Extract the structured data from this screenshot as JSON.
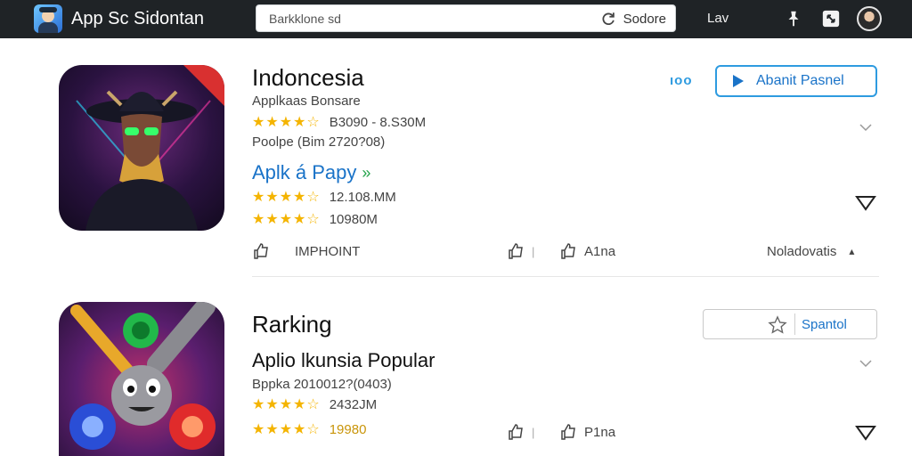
{
  "topbar": {
    "title": "App Sc Sidontan",
    "search_placeholder": "Barkklone sd",
    "search_button_label": "Sodore",
    "lav_label": "Lav",
    "icons": [
      "app-logo-icon",
      "pin-icon",
      "expand-icon",
      "avatar"
    ]
  },
  "apps": [
    {
      "title": "Indoncesia",
      "subtitle": "Applkaas Bonsare",
      "rating_1": "★★★★☆",
      "rating_1_value": "B3090 - 8.S30M",
      "people": "Poolpe (Bim 2720?08)",
      "link_label": "Aplk á Papy",
      "link_arrow": "»",
      "rating_2": "★★★★☆",
      "rating_2_value": "12.108.MM",
      "rating_3": "★★★★☆",
      "rating_3_value": "10980M",
      "more_label": "ıoo",
      "primary_button": "Abanit Pasnel",
      "impact_label": "IMPHOINT",
      "like_separator": "|",
      "reply_label": "A1na",
      "notification_label": "Noladovatis",
      "notification_arrow": "▴"
    },
    {
      "title": "Rarking",
      "subtitle": "Aplio lkunsia Popular",
      "people": "Bppka 2010012?(0403)",
      "rating_1": "★★★★☆",
      "rating_1_value": "2432JM",
      "rating_2": "★★★★☆",
      "rating_2_value": "19980",
      "secondary_button": "Spantol",
      "like_separator": "|",
      "reply_label": "P1na"
    }
  ],
  "colors": {
    "topbar": "#1f2326",
    "accent": "#1a73c8",
    "star": "#f4b400",
    "border_accent": "#2e9be0"
  }
}
